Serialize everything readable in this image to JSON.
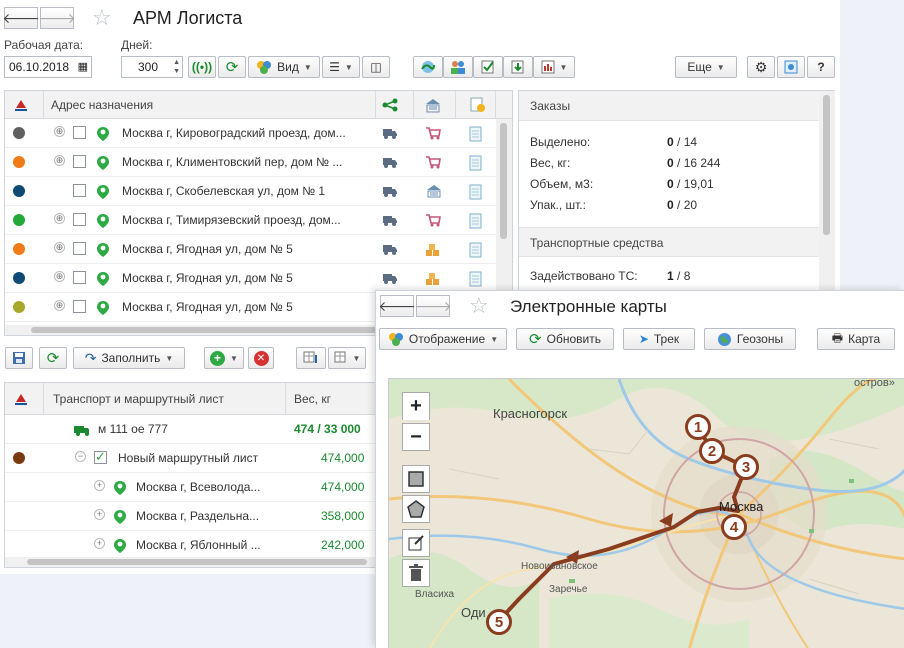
{
  "main": {
    "title": "АРМ Логиста",
    "work_date_label": "Рабочая дата:",
    "work_date_value": "06.10.2018",
    "days_label": "Дней:",
    "days_value": "300",
    "view_button": "Вид",
    "more_button": "Еще",
    "help_button": "?",
    "orders_grid": {
      "address_header": "Адрес назначения",
      "rows": [
        {
          "color": "#606060",
          "expand": "⊕",
          "address": "Москва г, Кировоградский проезд, дом..."
        },
        {
          "color": "#f07a18",
          "expand": "⊕",
          "address": "Москва г, Климентовский пер, дом № ..."
        },
        {
          "color": "#0f4a74",
          "expand": "",
          "address": "Москва г, Скобелевская ул, дом № 1"
        },
        {
          "color": "#22a93a",
          "expand": "⊕",
          "address": "Москва г, Тимирязевский проезд, дом..."
        },
        {
          "color": "#f07a18",
          "expand": "⊕",
          "address": "Москва г, Ягодная ул, дом № 5"
        },
        {
          "color": "#0f4a74",
          "expand": "⊕",
          "address": "Москва г, Ягодная ул, дом № 5"
        },
        {
          "color": "#a8a82a",
          "expand": "⊕",
          "address": "Москва г, Ягодная ул, дом № 5"
        }
      ]
    },
    "summary": {
      "orders_header": "Заказы",
      "allocated_label": "Выделено:",
      "allocated_value": "0",
      "allocated_total": " / 14",
      "weight_label": "Вес, кг:",
      "weight_value": "0",
      "weight_total": " / 16 244",
      "volume_label": "Объем, м3:",
      "volume_value": "0",
      "volume_total": " / 19,01",
      "packs_label": "Упак., шт.:",
      "packs_value": "0",
      "packs_total": " / 20",
      "vehicles_header": "Транспортные средства",
      "vehicles_label": "Задействовано ТС:",
      "vehicles_value": "1",
      "vehicles_total": " / 8"
    },
    "fill_button": "Заполнить",
    "transport_grid": {
      "col_transport": "Транспорт и маршрутный лист",
      "col_weight": "Вес, кг",
      "vehicle_plate": "м 111 ое 777",
      "vehicle_weight": "474 / 33 000",
      "route_sheet": "Новый маршрутный лист",
      "route_weight": "474,000",
      "stops": [
        {
          "address": "Москва г, Всеволода...",
          "weight": "474,000"
        },
        {
          "address": "Москва г, Раздельна...",
          "weight": "358,000"
        },
        {
          "address": "Москва г, Яблонный ...",
          "weight": "242,000"
        }
      ]
    }
  },
  "map_window": {
    "title": "Электронные карты",
    "display_button": "Отображение",
    "refresh_button": "Обновить",
    "track_button": "Трек",
    "geozones_button": "Геозоны",
    "map_button": "Карта",
    "zoom_in": "+",
    "zoom_out": "−",
    "labels": {
      "krasnogorsk": "Красногорск",
      "moscow": "Москва",
      "novoivanovskoe": "Новоивановское",
      "zarechye": "Заречье",
      "vlasikha": "Власиха",
      "odintsovo": "Оди",
      "ostrov": "остров»"
    },
    "markers": [
      "1",
      "2",
      "3",
      "4",
      "5"
    ]
  },
  "colors": {
    "route": "#8a3c1f",
    "marker_fill": "#ffffff",
    "green_total": "#1b8a2e"
  }
}
